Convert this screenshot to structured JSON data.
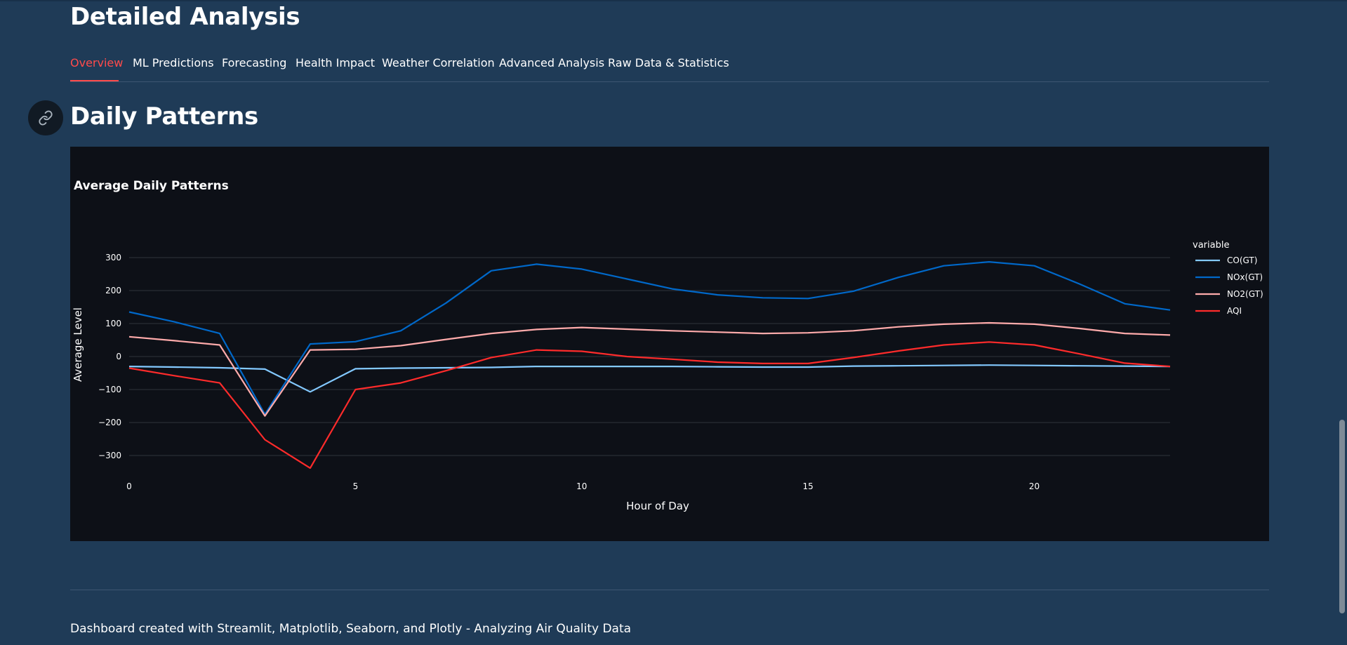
{
  "page": {
    "title": "Detailed Analysis"
  },
  "tabs": [
    {
      "label": "Overview",
      "active": true
    },
    {
      "label": "ML Predictions",
      "active": false
    },
    {
      "label": "Forecasting",
      "active": false
    },
    {
      "label": "Health Impact",
      "active": false
    },
    {
      "label": "Weather Correlation",
      "active": false
    },
    {
      "label": "Advanced Analysis",
      "active": false
    },
    {
      "label": "Raw Data & Statistics",
      "active": false
    }
  ],
  "section": {
    "title": "Daily Patterns",
    "anchor_icon": "link-icon"
  },
  "colors": {
    "accent": "#ff4b4b",
    "background": "#1f3b57",
    "chart_background": "#0d1017"
  },
  "chart_data": {
    "type": "line",
    "title": "Average Daily Patterns",
    "xlabel": "Hour of Day",
    "ylabel": "Average Level",
    "xlim": [
      0,
      23
    ],
    "ylim": [
      -385,
      385
    ],
    "xticks": [
      0,
      5,
      10,
      15,
      20
    ],
    "yticks": [
      -300,
      -200,
      -100,
      0,
      100,
      200,
      300
    ],
    "grid": true,
    "legend_title": "variable",
    "legend_position": "right",
    "x": [
      0,
      1,
      2,
      3,
      4,
      5,
      6,
      7,
      8,
      9,
      10,
      11,
      12,
      13,
      14,
      15,
      16,
      17,
      18,
      19,
      20,
      21,
      22,
      23
    ],
    "series": [
      {
        "name": "CO(GT)",
        "color": "#83c9ff",
        "values": [
          -30,
          -32,
          -34,
          -38,
          -107,
          -37,
          -35,
          -34,
          -33,
          -30,
          -30,
          -30,
          -30,
          -31,
          -32,
          -32,
          -29,
          -28,
          -27,
          -26,
          -27,
          -28,
          -29,
          -30
        ]
      },
      {
        "name": "NOx(GT)",
        "color": "#0068c9",
        "values": [
          135,
          105,
          70,
          -175,
          38,
          45,
          78,
          162,
          260,
          280,
          265,
          235,
          205,
          187,
          178,
          176,
          198,
          240,
          275,
          287,
          275,
          220,
          160,
          141
        ]
      },
      {
        "name": "NO2(GT)",
        "color": "#ffabab",
        "values": [
          60,
          48,
          35,
          -180,
          20,
          22,
          33,
          52,
          70,
          82,
          88,
          83,
          78,
          74,
          70,
          72,
          78,
          90,
          98,
          102,
          98,
          85,
          70,
          65
        ]
      },
      {
        "name": "AQI",
        "color": "#ff2b2b",
        "values": [
          -35,
          -58,
          -80,
          -252,
          -338,
          -100,
          -80,
          -43,
          -3,
          20,
          16,
          0,
          -8,
          -17,
          -21,
          -21,
          -3,
          17,
          35,
          44,
          35,
          8,
          -20,
          -30
        ]
      }
    ]
  },
  "footer": {
    "text": "Dashboard created with Streamlit, Matplotlib, Seaborn, and Plotly - Analyzing Air Quality Data"
  }
}
